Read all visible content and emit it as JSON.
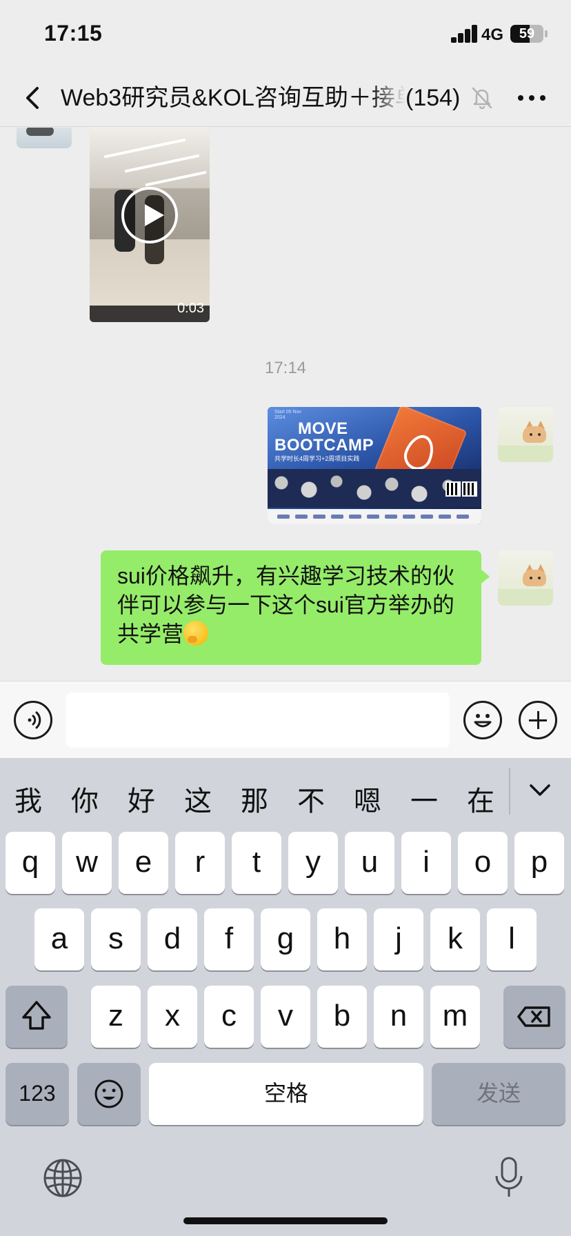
{
  "status_bar": {
    "time": "17:15",
    "network": "4G",
    "battery": "59",
    "battery_level": 0.59
  },
  "nav": {
    "title": "Web3研究员&KOL咨询互助＋接单",
    "member_count": "(154)",
    "back_icon": "chevron-left-icon",
    "mute_icon": "bell-off-icon",
    "more_icon": "ellipsis-icon"
  },
  "chat": {
    "video": {
      "duration": "0:03"
    },
    "timestamp": "17:14",
    "poster": {
      "title_line1": "MOVE",
      "title_line2": "BOOTCAMP",
      "date": "Start 05 Nov 2024",
      "subtitle": "共学时长4周学习+2周项目实践"
    },
    "message_text": "sui价格飙升，有兴趣学习技术的伙伴可以参与一下这个sui官方举办的共学营",
    "message_emoji": "thinking-face-emoji"
  },
  "input_bar": {
    "placeholder": "",
    "voice_icon": "voice-wave-icon",
    "emoji_icon": "smiley-icon",
    "plus_icon": "plus-circle-icon"
  },
  "keyboard": {
    "candidates": [
      "我",
      "你",
      "好",
      "这",
      "那",
      "不",
      "嗯",
      "一",
      "在"
    ],
    "row1": [
      "q",
      "w",
      "e",
      "r",
      "t",
      "y",
      "u",
      "i",
      "o",
      "p"
    ],
    "row2": [
      "a",
      "s",
      "d",
      "f",
      "g",
      "h",
      "j",
      "k",
      "l"
    ],
    "row3": [
      "z",
      "x",
      "c",
      "v",
      "b",
      "n",
      "m"
    ],
    "numbers_label": "123",
    "space_label": "空格",
    "send_label": "发送"
  }
}
